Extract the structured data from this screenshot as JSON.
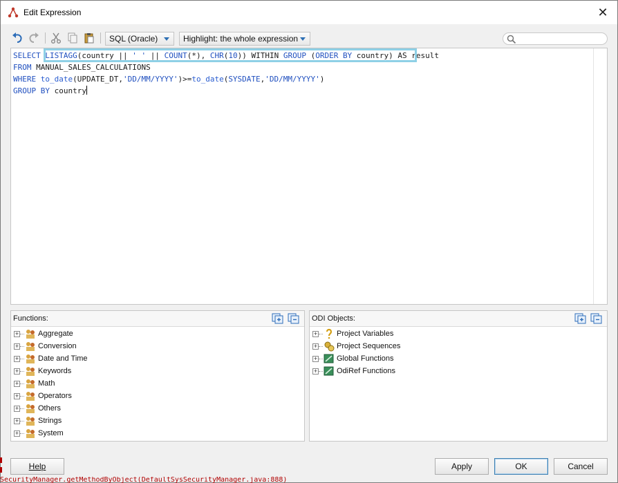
{
  "window": {
    "title": "Edit Expression",
    "close_glyph": "✕"
  },
  "toolbar": {
    "undo_icon": "undo-icon",
    "redo_icon": "redo-icon",
    "cut_icon": "cut-icon",
    "copy_icon": "copy-icon",
    "paste_icon": "paste-icon",
    "dialect_select": "SQL (Oracle)",
    "highlight_select": "Highlight: the whole expression",
    "search_placeholder": ""
  },
  "editor": {
    "lines": [
      "SELECT LISTAGG(country || ' ' || COUNT(*), CHR(10)) WITHIN GROUP (ORDER BY country) AS result",
      "FROM MANUAL_SALES_CALCULATIONS",
      "WHERE to_date(UPDATE_DT,'DD/MM/YYYY')>=to_date(SYSDATE,'DD/MM/YYYY')",
      "GROUP BY country"
    ]
  },
  "functions_panel": {
    "title": "Functions:",
    "items": [
      {
        "label": "Aggregate"
      },
      {
        "label": "Conversion"
      },
      {
        "label": "Date and Time"
      },
      {
        "label": "Keywords"
      },
      {
        "label": "Math"
      },
      {
        "label": "Operators"
      },
      {
        "label": "Others"
      },
      {
        "label": "Strings"
      },
      {
        "label": "System"
      }
    ]
  },
  "odi_panel": {
    "title": "ODI Objects:",
    "items": [
      {
        "label": "Project Variables",
        "icon": "variable-icon"
      },
      {
        "label": "Project Sequences",
        "icon": "sequence-icon"
      },
      {
        "label": "Global Functions",
        "icon": "function-icon"
      },
      {
        "label": "OdiRef Functions",
        "icon": "function-icon"
      }
    ]
  },
  "buttons": {
    "help": "Help",
    "apply": "Apply",
    "ok": "OK",
    "cancel": "Cancel"
  },
  "background_text": "SecurityManager.getMethodByObject(DefaultSysSecurityManager.java:888)",
  "colors": {
    "keyword": "#1f4fbf",
    "highlight_box": "#8ed0e6",
    "accent": "#3c7fb1"
  }
}
